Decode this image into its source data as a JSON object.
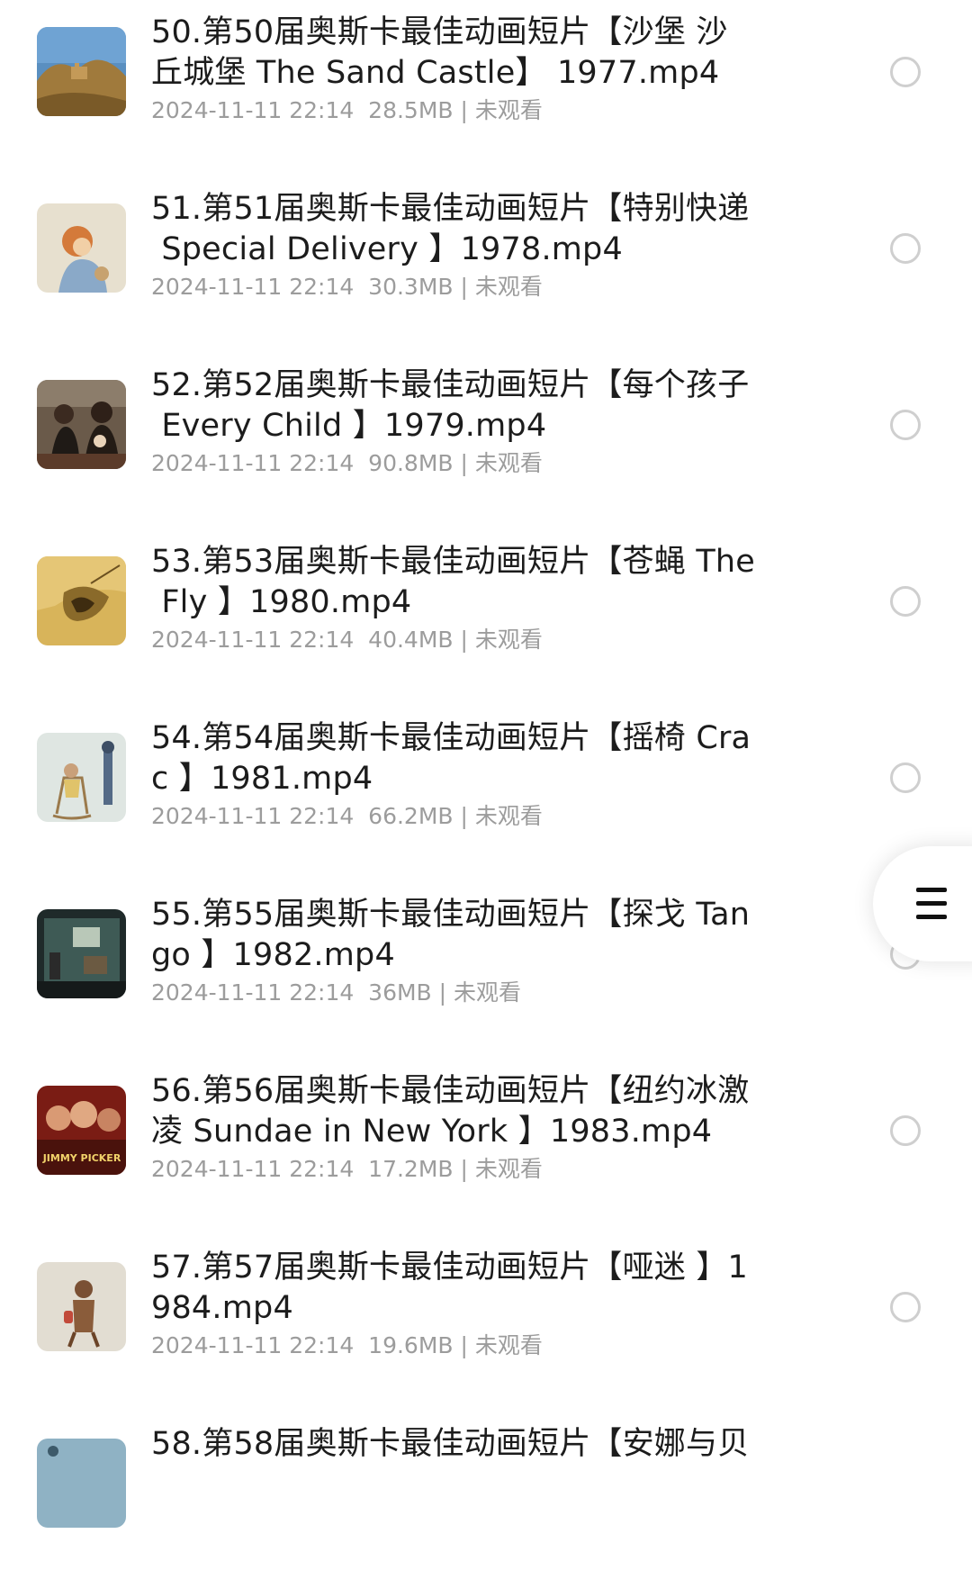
{
  "files": [
    {
      "title": "50.第50届奥斯卡最佳动画短片【沙堡 沙丘城堡 The Sand Castle】 1977.mp4",
      "line1": "50.第50届奥斯卡最佳动画短片【沙堡 沙",
      "line2": "丘城堡 The Sand Castle】 1977.mp4",
      "meta": "2024-11-11 22:14  28.5MB | 未观看",
      "thumb": "sand-castle-thumbnail"
    },
    {
      "title": "51.第51届奥斯卡最佳动画短片【特别快递 Special Delivery 】1978.mp4",
      "line1": "51.第51届奥斯卡最佳动画短片【特别快递",
      "line2": " Special Delivery 】1978.mp4",
      "meta": "2024-11-11 22:14  30.3MB | 未观看",
      "thumb": "special-delivery-thumbnail"
    },
    {
      "title": "52.第52届奥斯卡最佳动画短片【每个孩子 Every Child 】1979.mp4",
      "line1": "52.第52届奥斯卡最佳动画短片【每个孩子",
      "line2": " Every Child 】1979.mp4",
      "meta": "2024-11-11 22:14  90.8MB | 未观看",
      "thumb": "every-child-thumbnail"
    },
    {
      "title": "53.第53届奥斯卡最佳动画短片【苍蝇 The Fly 】1980.mp4",
      "line1": "53.第53届奥斯卡最佳动画短片【苍蝇 The",
      "line2": " Fly 】1980.mp4",
      "meta": "2024-11-11 22:14  40.4MB | 未观看",
      "thumb": "the-fly-thumbnail"
    },
    {
      "title": "54.第54届奥斯卡最佳动画短片【摇椅 Crac 】1981.mp4",
      "line1": "54.第54届奥斯卡最佳动画短片【摇椅 Cra",
      "line2": "c 】1981.mp4",
      "meta": "2024-11-11 22:14  66.2MB | 未观看",
      "thumb": "crac-thumbnail"
    },
    {
      "title": "55.第55届奥斯卡最佳动画短片【探戈 Tango 】1982.mp4",
      "line1": "55.第55届奥斯卡最佳动画短片【探戈 Tan",
      "line2": "go 】1982.mp4",
      "meta": "2024-11-11 22:14  36MB | 未观看",
      "thumb": "tango-thumbnail"
    },
    {
      "title": "56.第56届奥斯卡最佳动画短片【纽约冰激凌 Sundae in New York 】1983.mp4",
      "line1": "56.第56届奥斯卡最佳动画短片【纽约冰激",
      "line2": "凌 Sundae in New York 】1983.mp4",
      "meta": "2024-11-11 22:14  17.2MB | 未观看",
      "thumb": "sundae-in-new-york-thumbnail",
      "thumb_caption": "JIMMY PICKER"
    },
    {
      "title": "57.第57届奥斯卡最佳动画短片【哑迷 】1984.mp4",
      "line1": "57.第57届奥斯卡最佳动画短片【哑迷 】1",
      "line2": "984.mp4",
      "meta": "2024-11-11 22:14  19.6MB | 未观看",
      "thumb": "charade-thumbnail"
    },
    {
      "title": "58.第58届奥斯卡最佳动画短片【安娜与贝",
      "line1": "58.第58届奥斯卡最佳动画短片【安娜与贝",
      "line2": "",
      "meta": "",
      "thumb": "anna-and-bella-thumbnail"
    }
  ],
  "floating_menu": {
    "icon": "menu-icon"
  },
  "colors": {
    "title": "#1c1c1c",
    "meta": "#9c9c9c",
    "radio_border": "#cfcfcf",
    "background": "#ffffff"
  }
}
